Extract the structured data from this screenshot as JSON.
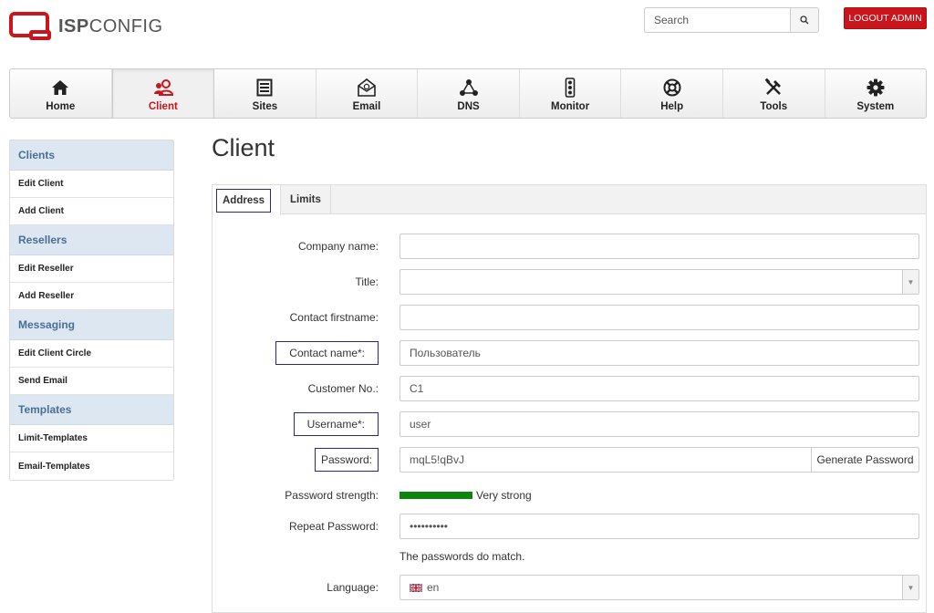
{
  "header": {
    "logo_text_bold": "ISP",
    "logo_text_light": "CONFIG",
    "search_placeholder": "Search",
    "logout_label": "LOGOUT ADMIN",
    "brand_color": "#c9151b"
  },
  "nav": {
    "items": [
      {
        "label": "Home",
        "icon": "home-icon"
      },
      {
        "label": "Client",
        "icon": "client-icon",
        "active": true
      },
      {
        "label": "Sites",
        "icon": "sites-icon"
      },
      {
        "label": "Email",
        "icon": "email-icon"
      },
      {
        "label": "DNS",
        "icon": "dns-icon"
      },
      {
        "label": "Monitor",
        "icon": "monitor-icon"
      },
      {
        "label": "Help",
        "icon": "help-icon"
      },
      {
        "label": "Tools",
        "icon": "tools-icon"
      },
      {
        "label": "System",
        "icon": "system-icon"
      }
    ]
  },
  "sidebar": {
    "sections": [
      {
        "title": "Clients",
        "items": [
          "Edit Client",
          "Add Client"
        ]
      },
      {
        "title": "Resellers",
        "items": [
          "Edit Reseller",
          "Add Reseller"
        ]
      },
      {
        "title": "Messaging",
        "items": [
          "Edit Client Circle",
          "Send Email"
        ]
      },
      {
        "title": "Templates",
        "items": [
          "Limit-Templates",
          "Email-Templates"
        ]
      }
    ]
  },
  "page": {
    "title": "Client",
    "tabs": [
      "Address",
      "Limits"
    ],
    "active_tab": "Address"
  },
  "form": {
    "company_name": {
      "label": "Company name:",
      "value": ""
    },
    "title": {
      "label": "Title:",
      "value": ""
    },
    "contact_firstname": {
      "label": "Contact firstname:",
      "value": ""
    },
    "contact_name": {
      "label": "Contact name*:",
      "value": "Пользователь"
    },
    "customer_no": {
      "label": "Customer No.:",
      "value": "C1"
    },
    "username": {
      "label": "Username*:",
      "value": "user"
    },
    "password": {
      "label": "Password:",
      "value": "mqL5!qBvJ",
      "generate_label": "Generate Password"
    },
    "password_strength": {
      "label": "Password strength:",
      "value": "Very strong",
      "color": "#0c850c",
      "level": 1.0
    },
    "repeat_password": {
      "label": "Repeat Password:",
      "value": "••••••••••"
    },
    "password_match_note": "The passwords do match.",
    "language": {
      "label": "Language:",
      "value": "en"
    }
  }
}
